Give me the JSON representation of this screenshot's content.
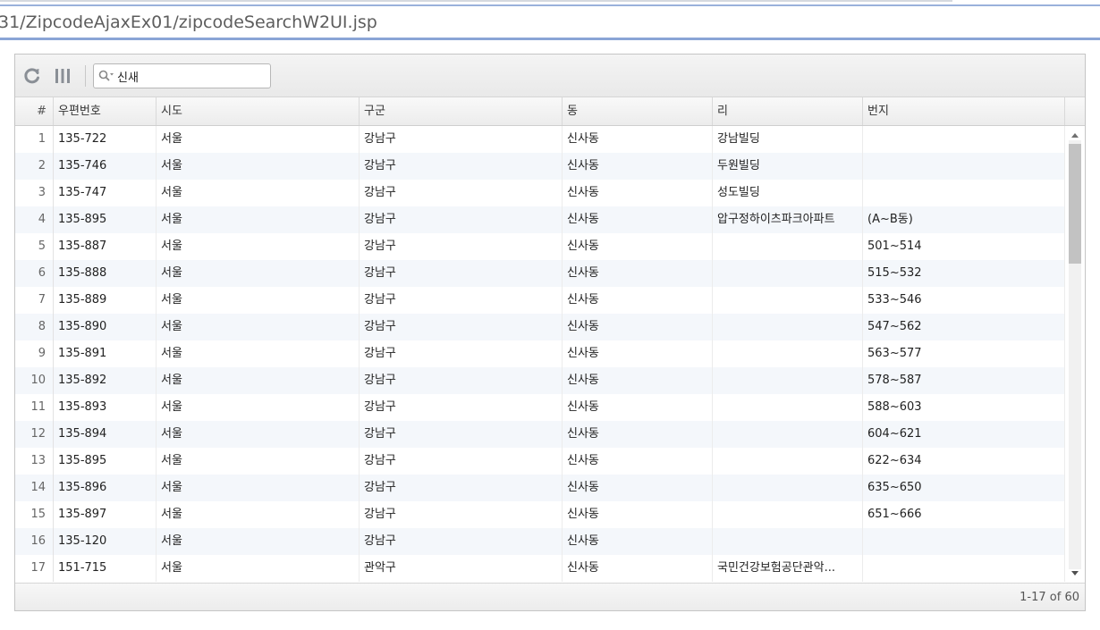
{
  "browser": {
    "url": "31/ZipcodeAjaxEx01/zipcodeSearchW2UI.jsp"
  },
  "toolbar": {
    "reload_icon": "reload-icon",
    "columns_icon": "columns-icon",
    "search_icon": "search-icon",
    "search_value": "신새"
  },
  "grid": {
    "columns": [
      "#",
      "우편번호",
      "시도",
      "구군",
      "동",
      "리",
      "번지"
    ],
    "rows": [
      {
        "n": "1",
        "zip": "135-722",
        "sido": "서울",
        "gugun": "강남구",
        "dong": "신사동",
        "ri": "강남빌딩",
        "bunji": ""
      },
      {
        "n": "2",
        "zip": "135-746",
        "sido": "서울",
        "gugun": "강남구",
        "dong": "신사동",
        "ri": "두원빌딩",
        "bunji": ""
      },
      {
        "n": "3",
        "zip": "135-747",
        "sido": "서울",
        "gugun": "강남구",
        "dong": "신사동",
        "ri": "성도빌딩",
        "bunji": ""
      },
      {
        "n": "4",
        "zip": "135-895",
        "sido": "서울",
        "gugun": "강남구",
        "dong": "신사동",
        "ri": "압구정하이츠파크아파트",
        "bunji": "(A~B동)"
      },
      {
        "n": "5",
        "zip": "135-887",
        "sido": "서울",
        "gugun": "강남구",
        "dong": "신사동",
        "ri": "",
        "bunji": "501~514"
      },
      {
        "n": "6",
        "zip": "135-888",
        "sido": "서울",
        "gugun": "강남구",
        "dong": "신사동",
        "ri": "",
        "bunji": "515~532"
      },
      {
        "n": "7",
        "zip": "135-889",
        "sido": "서울",
        "gugun": "강남구",
        "dong": "신사동",
        "ri": "",
        "bunji": "533~546"
      },
      {
        "n": "8",
        "zip": "135-890",
        "sido": "서울",
        "gugun": "강남구",
        "dong": "신사동",
        "ri": "",
        "bunji": "547~562"
      },
      {
        "n": "9",
        "zip": "135-891",
        "sido": "서울",
        "gugun": "강남구",
        "dong": "신사동",
        "ri": "",
        "bunji": "563~577"
      },
      {
        "n": "10",
        "zip": "135-892",
        "sido": "서울",
        "gugun": "강남구",
        "dong": "신사동",
        "ri": "",
        "bunji": "578~587"
      },
      {
        "n": "11",
        "zip": "135-893",
        "sido": "서울",
        "gugun": "강남구",
        "dong": "신사동",
        "ri": "",
        "bunji": "588~603"
      },
      {
        "n": "12",
        "zip": "135-894",
        "sido": "서울",
        "gugun": "강남구",
        "dong": "신사동",
        "ri": "",
        "bunji": "604~621"
      },
      {
        "n": "13",
        "zip": "135-895",
        "sido": "서울",
        "gugun": "강남구",
        "dong": "신사동",
        "ri": "",
        "bunji": "622~634"
      },
      {
        "n": "14",
        "zip": "135-896",
        "sido": "서울",
        "gugun": "강남구",
        "dong": "신사동",
        "ri": "",
        "bunji": "635~650"
      },
      {
        "n": "15",
        "zip": "135-897",
        "sido": "서울",
        "gugun": "강남구",
        "dong": "신사동",
        "ri": "",
        "bunji": "651~666"
      },
      {
        "n": "16",
        "zip": "135-120",
        "sido": "서울",
        "gugun": "강남구",
        "dong": "신사동",
        "ri": "",
        "bunji": ""
      },
      {
        "n": "17",
        "zip": "151-715",
        "sido": "서울",
        "gugun": "관악구",
        "dong": "신사동",
        "ri": "국민건강보험공단관악...",
        "bunji": ""
      }
    ]
  },
  "footer": {
    "status": "1-17 of 60"
  }
}
